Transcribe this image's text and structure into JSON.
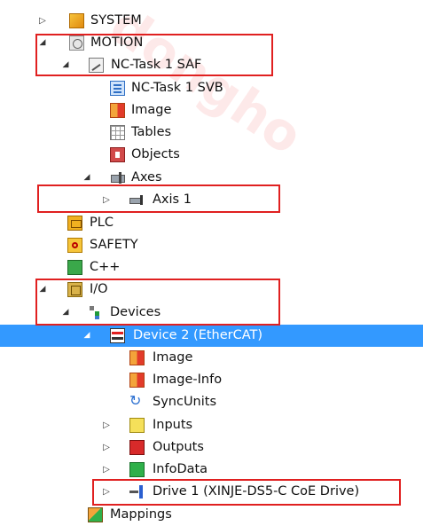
{
  "tree": {
    "system": {
      "label": "SYSTEM",
      "icon": "system-icon"
    },
    "motion": {
      "label": "MOTION",
      "icon": "motion-icon"
    },
    "nc_task": {
      "label": "NC-Task 1 SAF",
      "icon": "nc-task-icon"
    },
    "nc_task_svb": {
      "label": "NC-Task 1 SVB",
      "icon": "svb-icon"
    },
    "nc_image": {
      "label": "Image",
      "icon": "image-icon"
    },
    "tables": {
      "label": "Tables",
      "icon": "tables-icon"
    },
    "objects": {
      "label": "Objects",
      "icon": "objects-icon"
    },
    "axes": {
      "label": "Axes",
      "icon": "axes-icon"
    },
    "axis1": {
      "label": "Axis 1",
      "icon": "axis-icon"
    },
    "plc": {
      "label": "PLC",
      "icon": "plc-icon"
    },
    "safety": {
      "label": "SAFETY",
      "icon": "safety-icon"
    },
    "cpp": {
      "label": "C++",
      "icon": "cpp-icon"
    },
    "io": {
      "label": "I/O",
      "icon": "io-icon"
    },
    "devices": {
      "label": "Devices",
      "icon": "devices-icon"
    },
    "device2": {
      "label": "Device 2 (EtherCAT)",
      "icon": "ethercat-device-icon"
    },
    "dev_image": {
      "label": "Image",
      "icon": "image-icon"
    },
    "dev_image_info": {
      "label": "Image-Info",
      "icon": "image-info-icon"
    },
    "syncunits": {
      "label": "SyncUnits",
      "icon": "sync-icon"
    },
    "inputs": {
      "label": "Inputs",
      "icon": "inputs-icon"
    },
    "outputs": {
      "label": "Outputs",
      "icon": "outputs-icon"
    },
    "infodata": {
      "label": "InfoData",
      "icon": "infodata-icon"
    },
    "drive1": {
      "label": "Drive 1 (XINJE-DS5-C CoE Drive)",
      "icon": "drive-icon"
    },
    "mappings": {
      "label": "Mappings",
      "icon": "mappings-icon"
    }
  },
  "colors": {
    "selection": "#3399ff",
    "highlight_box": "#e02020"
  },
  "selected_item": "Device 2 (EtherCAT)"
}
